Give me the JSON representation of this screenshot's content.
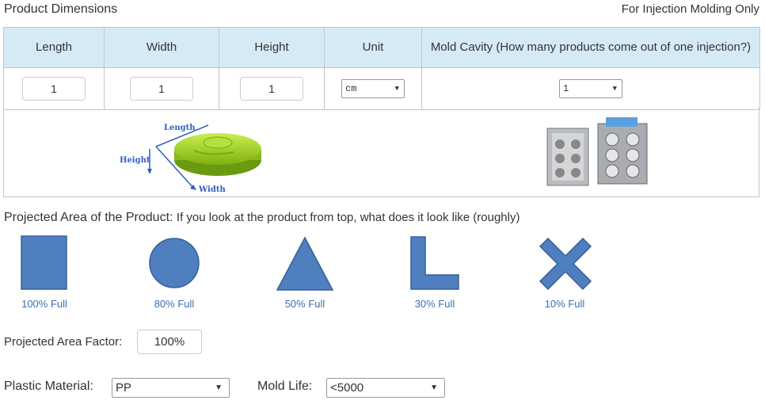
{
  "header": {
    "title": "Product Dimensions",
    "note": "For Injection Molding Only"
  },
  "table": {
    "columns": [
      "Length",
      "Width",
      "Height",
      "Unit",
      "Mold Cavity (How many products come out of one injection?)"
    ],
    "length_value": "1",
    "width_value": "1",
    "height_value": "1",
    "unit_selected": "cm",
    "cavity_selected": "1"
  },
  "diagram": {
    "length_label": "Length",
    "height_label": "Height",
    "width_label": "Width"
  },
  "projected": {
    "heading": "Projected Area of the Product:",
    "question": "If you look at the product from top, what does it look like (roughly)",
    "shapes": [
      {
        "label": "100% Full",
        "icon": "square-icon"
      },
      {
        "label": "80% Full",
        "icon": "circle-icon"
      },
      {
        "label": "50% Full",
        "icon": "triangle-icon"
      },
      {
        "label": "30% Full",
        "icon": "l-shape-icon"
      },
      {
        "label": "10% Full",
        "icon": "x-shape-icon"
      }
    ],
    "shape_color": "#4f7fbf"
  },
  "factor": {
    "label": "Projected Area Factor:",
    "value": "100%"
  },
  "material": {
    "label": "Plastic Material:",
    "selected": "PP"
  },
  "mold_life": {
    "label": "Mold Life:",
    "selected": "<5000"
  }
}
